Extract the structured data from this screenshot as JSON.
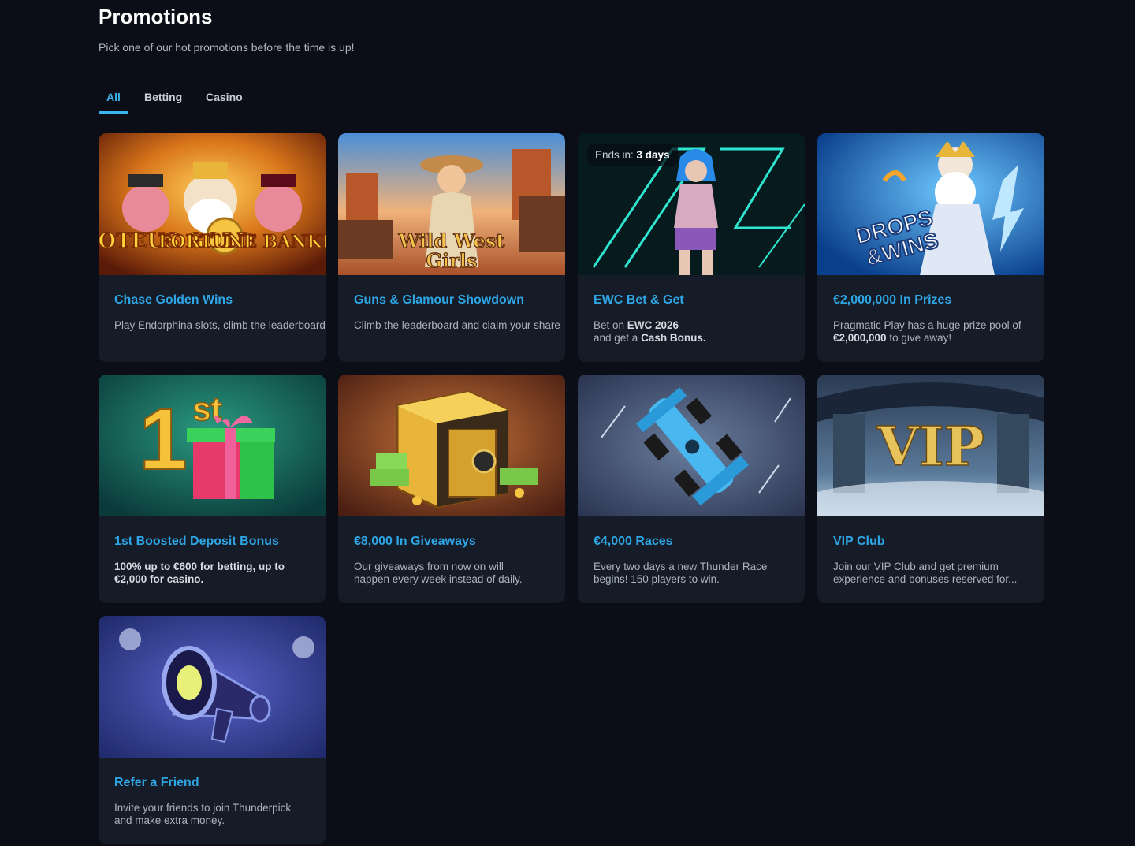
{
  "page": {
    "title": "Promotions",
    "subtitle": "Pick one of our hot promotions before the time is up!"
  },
  "tabs": [
    {
      "label": "All",
      "active": true
    },
    {
      "label": "Betting",
      "active": false
    },
    {
      "label": "Casino",
      "active": false
    }
  ],
  "colors": {
    "background": "#0b0e16",
    "card": "#161c27",
    "accent": "#3ab4ec",
    "title": "#2ea6e6"
  },
  "promotions": [
    {
      "title": "Chase Golden Wins",
      "description": "Play Endorphina slots, climb the leaderboard",
      "image_icon": "sloteus-gold-fortune-bankers-image",
      "image_text": [
        "SLOTEUS GOLD",
        "FORTUNE BANKERS"
      ]
    },
    {
      "title": "Guns & Glamour Showdown",
      "description": "Climb the leaderboard and claim your share",
      "image_icon": "wild-west-girls-image",
      "image_text": [
        "Wild West",
        "Girls"
      ]
    },
    {
      "title": "EWC Bet & Get",
      "description_parts": [
        "Bet on ",
        "EWC 2026",
        "and get a ",
        "Cash Bonus."
      ],
      "badge_prefix": "Ends in: ",
      "badge_value": "3 days",
      "image_icon": "esports-character-image"
    },
    {
      "title": "€2,000,000 In Prizes",
      "description_parts": [
        "Pragmatic Play has a huge prize pool of ",
        "€2,000,000",
        " to give away!"
      ],
      "image_icon": "drops-and-wins-zeus-image",
      "image_text": [
        "DROPS",
        "&WINS"
      ]
    },
    {
      "title": "1st Boosted Deposit Bonus",
      "description_parts": [
        "100% up to €600 for betting, up to",
        "€2,000 for casino."
      ],
      "image_icon": "first-deposit-gift-image",
      "image_text": [
        "1",
        "st"
      ]
    },
    {
      "title": "€8,000 In Giveaways",
      "description": "Our giveaways from now on will happen every week instead of daily.",
      "image_icon": "treasure-safe-image"
    },
    {
      "title": "€4,000 Races",
      "description": "Every two days a new Thunder Race begins! 150 players to win.",
      "image_icon": "race-car-image"
    },
    {
      "title": "VIP Club",
      "description": "Join our VIP Club and get premium experience and bonuses reserved for...",
      "image_icon": "vip-club-image",
      "image_text": [
        "VIP"
      ]
    },
    {
      "title": "Refer a Friend",
      "description": "Invite your friends to join Thunderpick and make extra money.",
      "image_icon": "megaphone-image"
    }
  ]
}
